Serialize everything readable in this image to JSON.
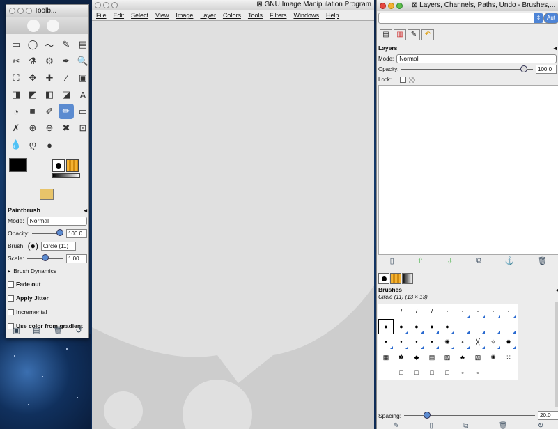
{
  "toolbox": {
    "title": "Toolb...",
    "tools": [
      "▭",
      "◯",
      "〜",
      "✎",
      "▤",
      "✂",
      "⚗",
      "⚙",
      "✒",
      "🔍",
      "⛶",
      "✥",
      "✚",
      "⁄",
      "▣",
      "◨",
      "◩",
      "◧",
      "◪",
      "A",
      "◔",
      "◾",
      "✐",
      "✏",
      "▭",
      "✗",
      "⊕",
      "⊖",
      "✖",
      "⊡",
      "💧",
      "ღ",
      "●"
    ],
    "options_title": "Paintbrush",
    "mode_label": "Mode:",
    "mode_value": "Normal",
    "opacity_label": "Opacity:",
    "opacity_value": "100.0",
    "brush_label": "Brush:",
    "brush_value": "Circle (11)",
    "scale_label": "Scale:",
    "scale_value": "1.00",
    "brush_dynamics": "Brush Dynamics",
    "fade_out": "Fade out",
    "apply_jitter": "Apply Jitter",
    "incremental": "Incremental",
    "use_color_gradient": "Use color from gradient"
  },
  "main": {
    "title": "GNU Image Manipulation Program",
    "menu": [
      "File",
      "Edit",
      "Select",
      "View",
      "Image",
      "Layer",
      "Colors",
      "Tools",
      "Filters",
      "Windows",
      "Help"
    ]
  },
  "dock": {
    "title": "Layers, Channels, Paths, Undo - Brushes,...",
    "auto_label": "Aut",
    "layers_title": "Layers",
    "mode_label": "Mode:",
    "mode_value": "Normal",
    "opacity_label": "Opacity:",
    "opacity_value": "100.0",
    "lock_label": "Lock:",
    "brushes_title": "Brushes",
    "brushes_sub": "Circle (11) (13 × 13)",
    "spacing_label": "Spacing:",
    "spacing_value": "20.0",
    "brush_cells": [
      "",
      "/",
      "/",
      "/",
      "·",
      "·",
      "·",
      "·",
      "·",
      "●",
      "●",
      "●",
      "●",
      "●",
      "·",
      "·",
      "·",
      "·",
      "•",
      "•",
      "•",
      "•",
      "✺",
      "×",
      "╳",
      "✧",
      "✹",
      "▦",
      "✽",
      "◆",
      "▤",
      "▧",
      "♣",
      "▨",
      "✺",
      "⁙",
      "·",
      "□",
      "□",
      "□",
      "□",
      "▫",
      "▫",
      "",
      ""
    ]
  }
}
